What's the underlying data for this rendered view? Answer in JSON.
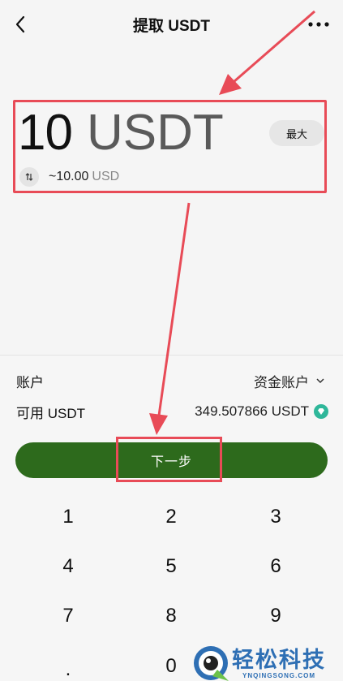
{
  "header": {
    "title": "提取 USDT",
    "back_icon": "chevron-left-icon",
    "more_icon": "more-dots-icon"
  },
  "amount": {
    "value": "10",
    "unit": "USDT",
    "max_label": "最大",
    "converted_value": "~10.00",
    "converted_currency": "USD",
    "swap_icon": "swap-icon"
  },
  "account": {
    "label": "账户",
    "value": "资金账户"
  },
  "available": {
    "label": "可用 USDT",
    "value": "349.507866 USDT",
    "badge_color": "#2fb79a"
  },
  "next_button": {
    "label": "下一步",
    "color": "#2d6a1c"
  },
  "annotation": {
    "color": "#e84b57"
  },
  "keypad": {
    "keys": [
      "1",
      "2",
      "3",
      "4",
      "5",
      "6",
      "7",
      "8",
      "9",
      ".",
      "0"
    ]
  },
  "watermark": {
    "brand": "轻松科技",
    "domain": "YNQINGSONG.COM"
  }
}
